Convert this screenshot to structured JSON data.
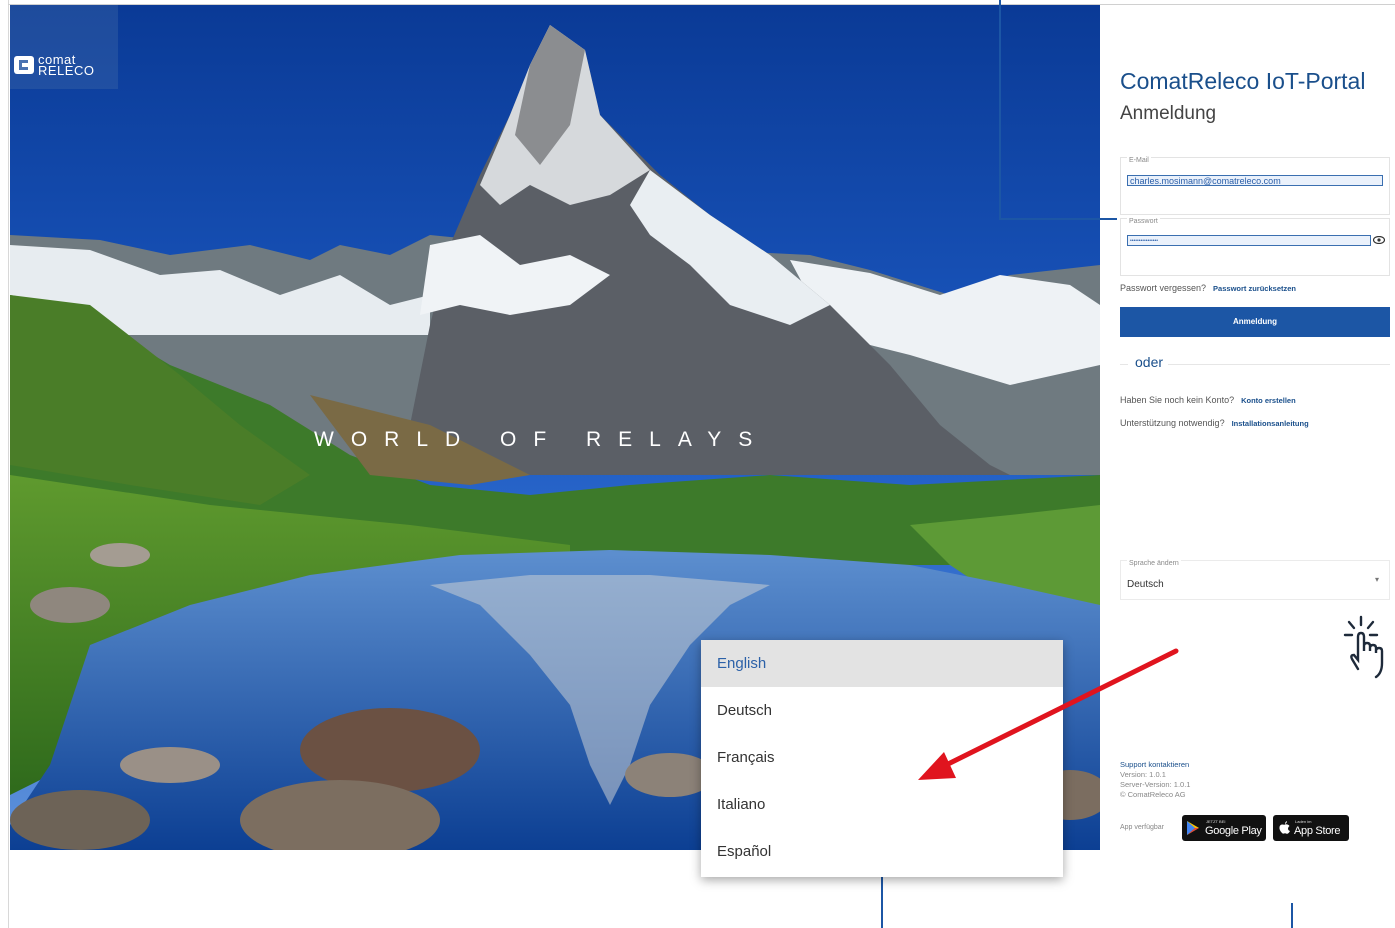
{
  "hero": {
    "tagline": "WORLD OF RELAYS",
    "logo": {
      "line1": "comat",
      "line2": "RELECO"
    }
  },
  "login_panel": {
    "title": "ComatReleco IoT-Portal",
    "subtitle": "Anmeldung",
    "email": {
      "label": "E-Mail",
      "value": "charles.mosimann@comatreleco.com"
    },
    "password": {
      "label": "Passwort",
      "value": "••••••••••••••••"
    },
    "forgot": {
      "text": "Passwort vergessen?",
      "link": "Passwort zurücksetzen"
    },
    "login_button": "Anmeldung",
    "divider": "oder",
    "no_account": {
      "text": "Haben Sie noch kein Konto?",
      "link": "Konto erstellen"
    },
    "support_needed": {
      "text": "Unterstützung notwendig?",
      "link": "Installationsanleitung"
    },
    "language": {
      "label": "Sprache ändern",
      "value": "Deutsch"
    },
    "footer": {
      "support_link": "Support kontaktieren",
      "version": "Version: 1.0.1",
      "server_version": "Server-Version: 1.0.1",
      "copyright": "© ComatReleco AG",
      "app_available": "App verfügbar",
      "google_play_small": "JETZT BEI",
      "google_play": "Google Play",
      "app_store_small": "Laden im",
      "app_store": "App Store"
    }
  },
  "language_dropdown": {
    "options": [
      "English",
      "Deutsch",
      "Français",
      "Italiano",
      "Español"
    ],
    "highlighted": "English"
  },
  "colors": {
    "brand_blue": "#1c56a5",
    "title_blue": "#1a4f8b",
    "arrow_red": "#e0141e"
  },
  "icons": [
    "eye-icon",
    "tap-gesture-icon",
    "google-play-icon",
    "apple-icon",
    "comat-logo"
  ]
}
